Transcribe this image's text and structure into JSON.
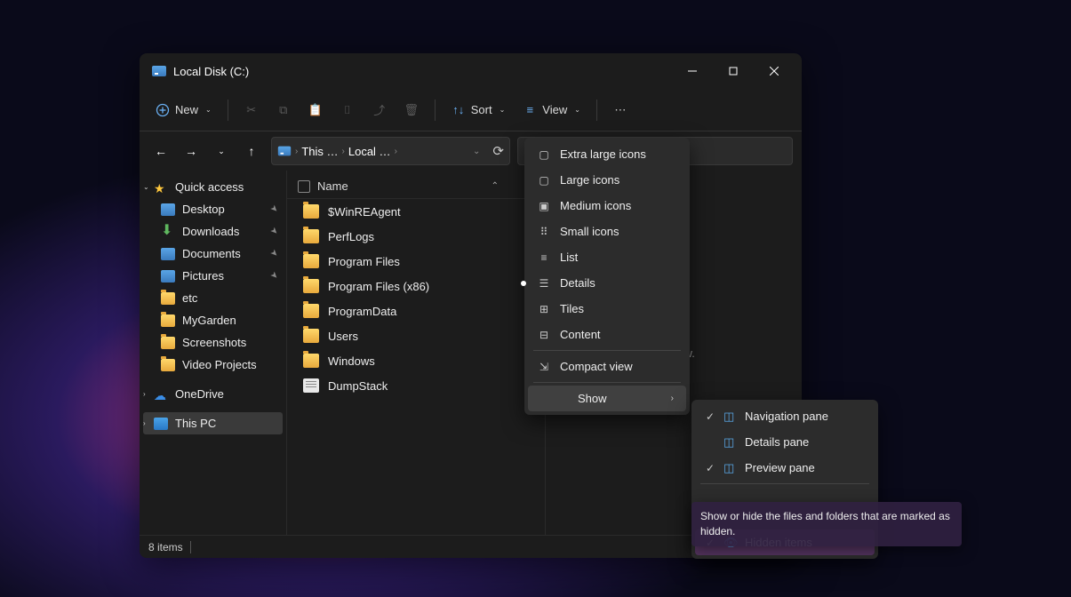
{
  "titlebar": {
    "title": "Local Disk (C:)"
  },
  "toolbar": {
    "new_label": "New",
    "sort_label": "Sort",
    "view_label": "View"
  },
  "address": {
    "seg1": "This …",
    "seg2": "Local …"
  },
  "sidebar": {
    "quick_access": "Quick access",
    "desktop": "Desktop",
    "downloads": "Downloads",
    "documents": "Documents",
    "pictures": "Pictures",
    "etc": "etc",
    "mygarden": "MyGarden",
    "screenshots": "Screenshots",
    "video_projects": "Video Projects",
    "onedrive": "OneDrive",
    "this_pc": "This PC"
  },
  "columns": {
    "name": "Name"
  },
  "files": [
    "$WinREAgent",
    "PerfLogs",
    "Program Files",
    "Program Files (x86)",
    "ProgramData",
    "Users",
    "Windows",
    "DumpStack"
  ],
  "preview": {
    "empty": "preview."
  },
  "status": {
    "count": "8 items"
  },
  "view_menu": {
    "xl": "Extra large icons",
    "lg": "Large icons",
    "md": "Medium icons",
    "sm": "Small icons",
    "list": "List",
    "details": "Details",
    "tiles": "Tiles",
    "content": "Content",
    "compact": "Compact view",
    "show": "Show"
  },
  "show_menu": {
    "nav": "Navigation pane",
    "details": "Details pane",
    "preview": "Preview pane",
    "hidden": "Hidden items"
  },
  "tooltip": {
    "text": "Show or hide the files and folders that are marked as hidden."
  }
}
